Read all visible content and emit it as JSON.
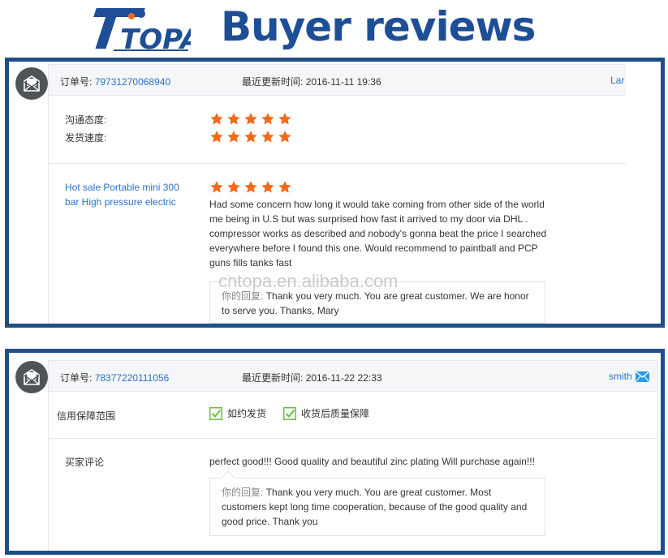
{
  "header": {
    "logo_text": "TOPA",
    "title": "Buyer reviews"
  },
  "colors": {
    "brand_blue": "#1e4f96",
    "panel_border": "#1f4e86",
    "link_blue": "#2b72c4",
    "star_orange": "#f26a1b",
    "check_green": "#6cbf3b"
  },
  "review1": {
    "order_label": "订单号:",
    "order_number": "79731270068940",
    "update_label": "最近更新时间:",
    "update_time": "2016-11-11 19:36",
    "user": "Lar",
    "ratings": [
      {
        "label": "沟通态度:",
        "stars": 5
      },
      {
        "label": "发货速度:",
        "stars": 5
      }
    ],
    "product": "Hot sale Portable mini 300 bar High pressure electric",
    "product_stars": 5,
    "text": "Had some concern how long it would take coming from other side of the world me being in U.S but was surprised how fast it arrived to my door via DHL . compressor works as described and nobody's gonna beat the price I searched everywhere before I found this one. Would recommend to paintball and PCP guns fills tanks fast",
    "reply_label": "你的回复:",
    "reply_text": "Thank you very much. You are great customer. We are honor to serve you. Thanks, Mary",
    "watermark": "cntopa.en.alibaba.com"
  },
  "review2": {
    "order_label": "订单号:",
    "order_number": "78377220111056",
    "update_label": "最近更新时间:",
    "update_time": "2016-11-22 22:33",
    "user": "smith",
    "guarantee_label": "信用保障范围",
    "guarantees": [
      "如约发货",
      "收货后质量保障"
    ],
    "review_label": "买家评论",
    "text": "perfect good!!! Good quality and beautiful zinc plating Will purchase again!!!",
    "reply_label": "你的回复:",
    "reply_text": "Thank you very much. You are great customer. Most customers kept long time cooperation, because of the good quality and good price. Thank you"
  }
}
